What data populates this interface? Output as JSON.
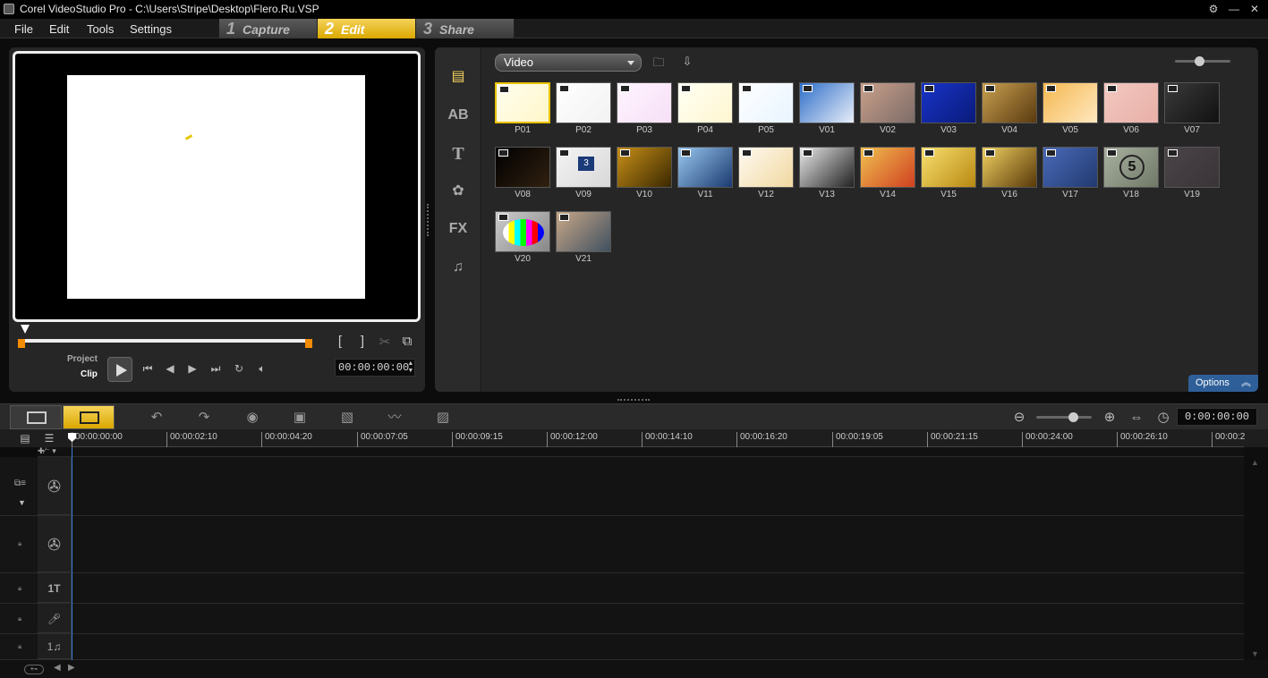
{
  "titlebar": {
    "title": "Corel VideoStudio Pro - C:\\Users\\Stripe\\Desktop\\Flero.Ru.VSP"
  },
  "menubar": {
    "items": [
      "File",
      "Edit",
      "Tools",
      "Settings"
    ],
    "steps": [
      {
        "num": "1",
        "label": "Capture"
      },
      {
        "num": "2",
        "label": "Edit",
        "active": true
      },
      {
        "num": "3",
        "label": "Share"
      }
    ]
  },
  "preview": {
    "mode_project": "Project",
    "mode_clip": "Clip",
    "timecode": "00:00:00:00"
  },
  "library": {
    "category": "Video",
    "sidebar": [
      "media-icon",
      "transition-icon",
      "title-icon",
      "graphic-icon",
      "filter-icon",
      "audio-icon"
    ],
    "sidebar_labels": {
      "transition": "AB",
      "title": "T",
      "filter": "FX"
    },
    "thumbs": [
      {
        "label": "P01",
        "colors": [
          "#fffef0",
          "#fff6c8"
        ],
        "selected": true
      },
      {
        "label": "P02",
        "colors": [
          "#ffffff",
          "#f2f2f2"
        ]
      },
      {
        "label": "P03",
        "colors": [
          "#fff4ff",
          "#f6e0f6"
        ]
      },
      {
        "label": "P04",
        "colors": [
          "#fffff4",
          "#fff6d0"
        ]
      },
      {
        "label": "P05",
        "colors": [
          "#ffffff",
          "#e8f4ff"
        ]
      },
      {
        "label": "V01",
        "colors": [
          "#2f6fc9",
          "#e8eef8"
        ]
      },
      {
        "label": "V02",
        "colors": [
          "#c9a08a",
          "#7d6c68"
        ]
      },
      {
        "label": "V03",
        "colors": [
          "#1834c8",
          "#0a1a7a"
        ]
      },
      {
        "label": "V04",
        "colors": [
          "#c8a050",
          "#5a3a10"
        ]
      },
      {
        "label": "V05",
        "colors": [
          "#f5b850",
          "#ffe8c0"
        ]
      },
      {
        "label": "V06",
        "colors": [
          "#f2c8c0",
          "#e8b0a8"
        ]
      },
      {
        "label": "V07",
        "colors": [
          "#3a3a3a",
          "#111111"
        ]
      },
      {
        "label": "V08",
        "colors": [
          "#000000",
          "#302010"
        ]
      },
      {
        "label": "V09",
        "colors": [
          "#f4f4f4",
          "#d8d8d8"
        ],
        "overlay": "3"
      },
      {
        "label": "V10",
        "colors": [
          "#c89018",
          "#3a2800"
        ]
      },
      {
        "label": "V11",
        "colors": [
          "#9ac8f0",
          "#1a3a70"
        ]
      },
      {
        "label": "V12",
        "colors": [
          "#fffaf0",
          "#f0d8a0"
        ]
      },
      {
        "label": "V13",
        "colors": [
          "#e8e8e8",
          "#222222"
        ]
      },
      {
        "label": "V14",
        "colors": [
          "#f0c050",
          "#d04020"
        ]
      },
      {
        "label": "V15",
        "colors": [
          "#f8e070",
          "#b88810"
        ]
      },
      {
        "label": "V16",
        "colors": [
          "#f0d060",
          "#583808"
        ]
      },
      {
        "label": "V17",
        "colors": [
          "#4a6ab8",
          "#223a70"
        ]
      },
      {
        "label": "V18",
        "colors": [
          "#a8b0a0",
          "#707868"
        ],
        "overlay": "5"
      },
      {
        "label": "V19",
        "colors": [
          "#4a4448",
          "#3a3438"
        ]
      },
      {
        "label": "V20",
        "colors": [
          "#cccccc",
          "#888888"
        ],
        "overlay": "bars"
      },
      {
        "label": "V21",
        "colors": [
          "#c8a888",
          "#405060"
        ]
      }
    ],
    "options_label": "Options"
  },
  "timeline": {
    "timecode": "0:00:00:00",
    "ruler": [
      "00:00:00:00",
      "00:00:02:10",
      "00:00:04:20",
      "00:00:07:05",
      "00:00:09:15",
      "00:00:12:00",
      "00:00:14:10",
      "00:00:16:20",
      "00:00:19:05",
      "00:00:21:15",
      "00:00:24:00",
      "00:00:26:10",
      "00:00:2"
    ],
    "tracks": [
      {
        "name": "video-track",
        "icon": "film-reel-icon"
      },
      {
        "name": "overlay-track",
        "icon": "overlay-reel-icon"
      },
      {
        "name": "title-track",
        "icon": "title-icon",
        "label": "1T"
      },
      {
        "name": "voice-track",
        "icon": "voice-icon"
      },
      {
        "name": "music-track",
        "icon": "music-icon",
        "label": "1♫"
      }
    ]
  }
}
